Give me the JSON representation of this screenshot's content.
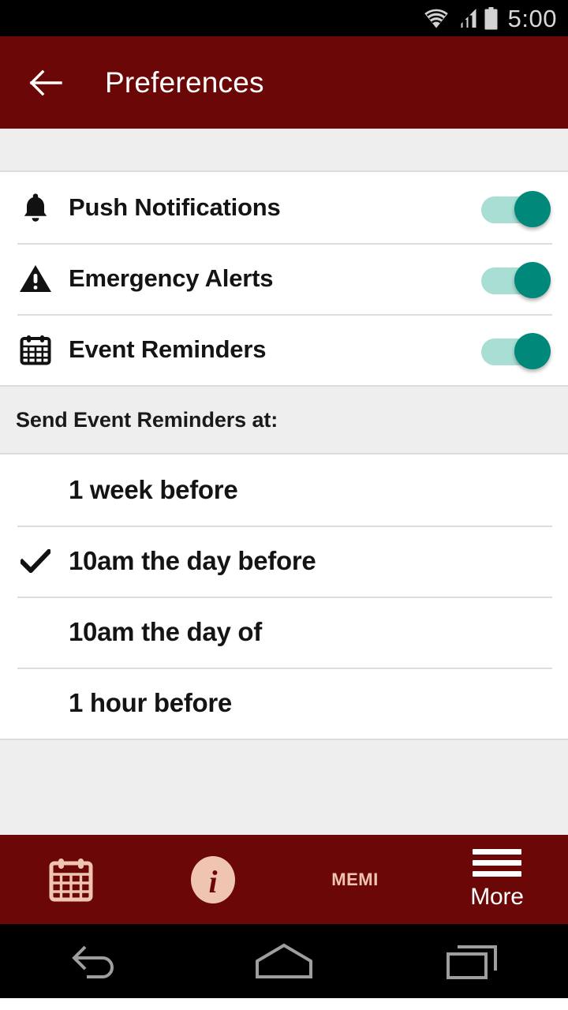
{
  "status_bar": {
    "time": "5:00",
    "icons": [
      "wifi-icon",
      "cellular-signal-icon",
      "battery-icon"
    ]
  },
  "app_bar": {
    "title": "Preferences",
    "back_icon": "back-arrow-icon",
    "background_color": "#6b0707",
    "title_color": "#ffffff"
  },
  "settings": {
    "toggles": [
      {
        "icon": "bell-icon",
        "label": "Push Notifications",
        "state": "on"
      },
      {
        "icon": "warning-triangle-icon",
        "label": "Emergency Alerts",
        "state": "on"
      },
      {
        "icon": "calendar-icon",
        "label": "Event Reminders",
        "state": "on"
      }
    ],
    "toggle_colors": {
      "track": "#a8ded4",
      "thumb": "#00897b"
    }
  },
  "reminder_section": {
    "header": "Send Event Reminders at:",
    "options": [
      {
        "label": "1 week before",
        "selected": false
      },
      {
        "label": "10am the day before",
        "selected": true
      },
      {
        "label": "10am the day of",
        "selected": false
      },
      {
        "label": "1 hour before",
        "selected": false
      }
    ]
  },
  "tab_bar": {
    "background_color": "#6b0707",
    "inactive_color": "#f0c5b0",
    "active_color": "#ffffff",
    "tabs": [
      {
        "icon": "calendar-icon",
        "label": "",
        "active": false
      },
      {
        "icon": "info-icon",
        "label": "",
        "active": false
      },
      {
        "icon": "memi-logo",
        "label": "MEMI",
        "active": false
      },
      {
        "icon": "hamburger-menu-icon",
        "label": "More",
        "active": true
      }
    ]
  },
  "android_nav": {
    "buttons": [
      "back-nav-icon",
      "home-nav-icon",
      "recents-nav-icon"
    ]
  }
}
